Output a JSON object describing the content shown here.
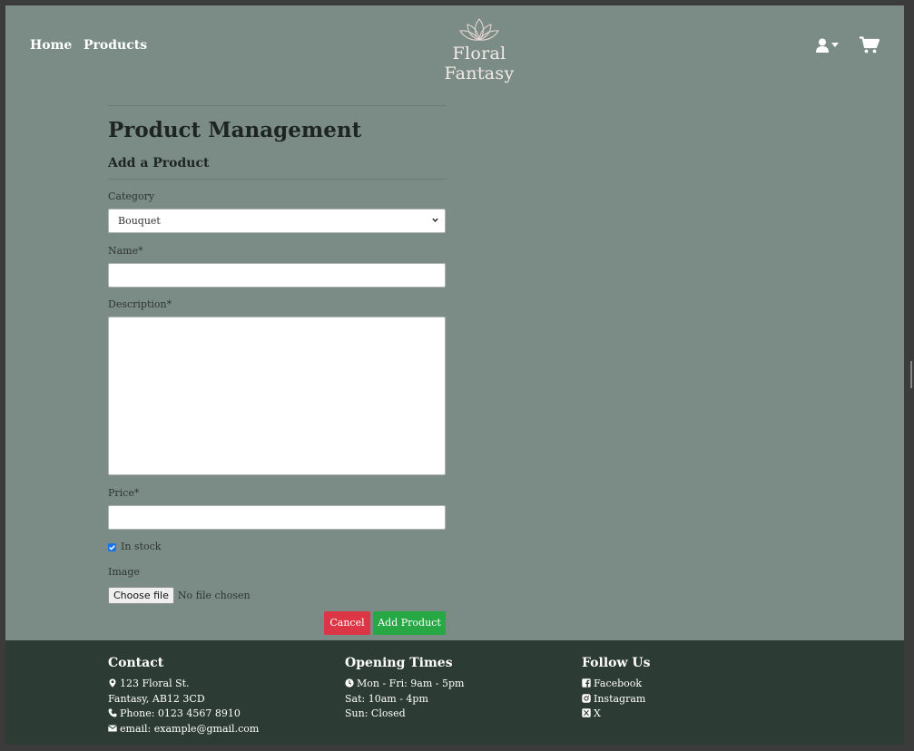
{
  "header": {
    "nav": [
      {
        "label": "Home"
      },
      {
        "label": "Products"
      }
    ],
    "brand": "Floral Fantasy",
    "icons": {
      "user": "user-icon",
      "dropdown": "caret-down-icon",
      "cart": "cart-icon",
      "logo": "lotus-icon"
    }
  },
  "form": {
    "title": "Product Management",
    "subtitle": "Add a Product",
    "category_label": "Category",
    "category_value": "Bouquet",
    "name_label": "Name*",
    "name_value": "",
    "description_label": "Description*",
    "description_value": "",
    "price_label": "Price*",
    "price_value": "",
    "in_stock_label": "In stock",
    "in_stock_checked": true,
    "image_label": "Image",
    "file_button": "Choose file",
    "file_status": "No file chosen",
    "cancel_label": "Cancel",
    "submit_label": "Add Product"
  },
  "footer": {
    "contact": {
      "heading": "Contact",
      "address1": "123 Floral St.",
      "address2": "Fantasy, AB12 3CD",
      "phone": "Phone: 0123 4567 8910",
      "email": "email: example@gmail.com"
    },
    "opening": {
      "heading": "Opening Times",
      "weekdays": "Mon - Fri: 9am - 5pm",
      "saturday": "Sat: 10am - 4pm",
      "sunday": "Sun: Closed"
    },
    "social": {
      "heading": "Follow Us",
      "facebook": "Facebook",
      "instagram": "Instagram",
      "x": "X"
    }
  },
  "colors": {
    "page_bg": "#7a8c85",
    "footer_bg": "#2d3b35",
    "cancel": "#dc3545",
    "submit": "#28a745"
  }
}
